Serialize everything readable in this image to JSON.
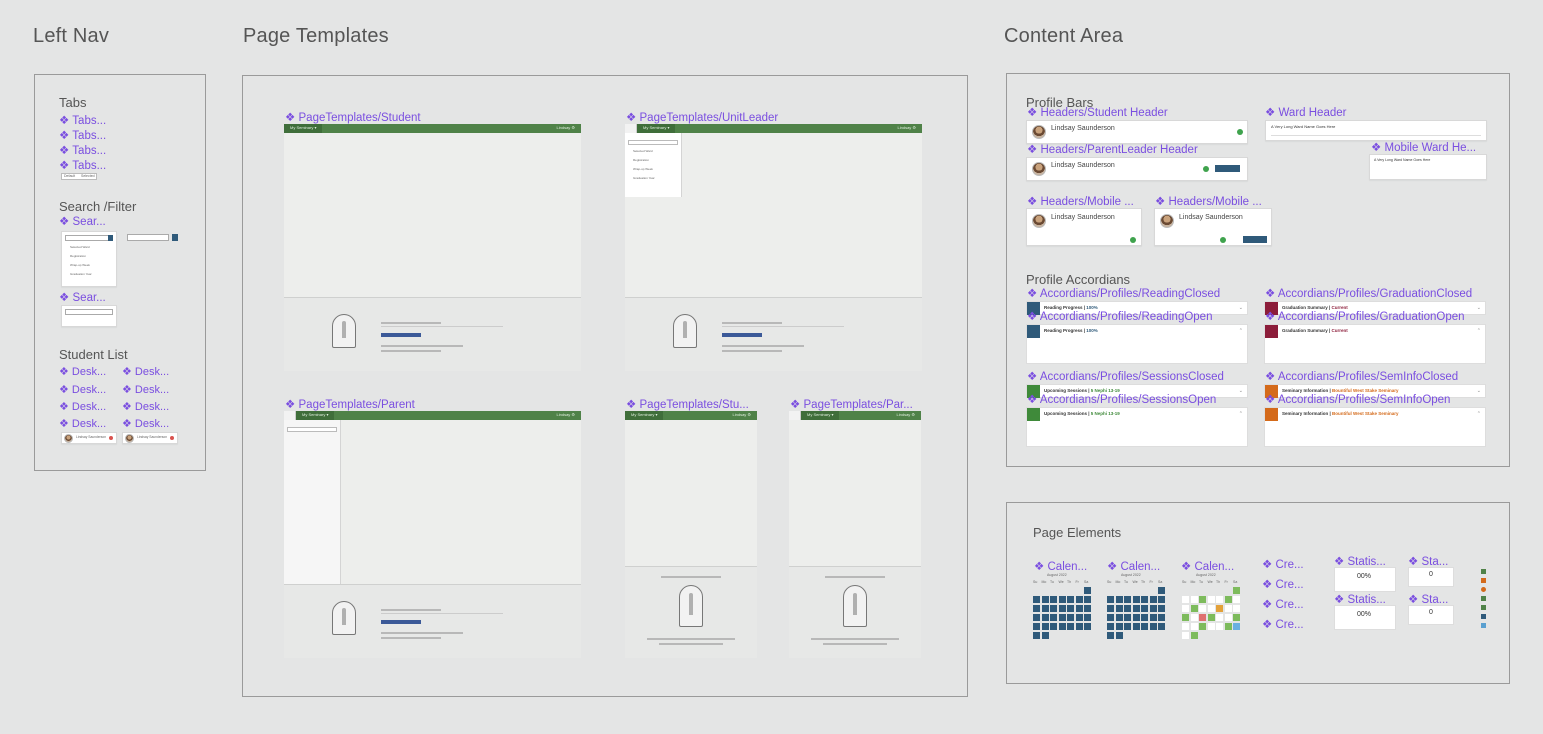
{
  "sections": {
    "left_nav": "Left Nav",
    "page_templates": "Page Templates",
    "content_area": "Content Area"
  },
  "left_nav": {
    "tabs_label": "Tabs",
    "tabs_components": [
      "❖ Tabs...",
      "❖ Tabs...",
      "❖ Tabs...",
      "❖ Tabs..."
    ],
    "tab_buttons": [
      "Default",
      "Selected"
    ],
    "search_label": "Search /Filter",
    "search_components": [
      "❖ Sear...",
      "❖ Sear..."
    ],
    "search_menu_items": [
      "Selected Ward",
      "Registration",
      "Wrap-up Week",
      "Graduation Year"
    ],
    "student_list_label": "Student List",
    "student_components": [
      "❖ Desk...",
      "❖ Desk...",
      "❖ Desk...",
      "❖ Desk...",
      "❖ Desk...",
      "❖ Desk...",
      "❖ Desk...",
      "❖ Desk..."
    ],
    "student_name": "Lindsay Saunderson"
  },
  "page_templates": {
    "student": "❖ PageTemplates/Student",
    "unit_leader": "❖ PageTemplates/UnitLeader",
    "parent": "❖ PageTemplates/Parent",
    "stu_mobile": "❖ PageTemplates/Stu...",
    "par_mobile": "❖ PageTemplates/Par...",
    "topbar_left": "My Seminary ▾",
    "topbar_right": "Lindsay ⚙"
  },
  "content_area": {
    "profile_bars_label": "Profile Bars",
    "student_header": "❖ Headers/Student Header",
    "ward_header": "❖ Ward Header",
    "parent_header": "❖ Headers/ParentLeader Header",
    "mobile_ward": "❖ Mobile Ward He...",
    "mobile_1": "❖ Headers/Mobile ...",
    "mobile_2": "❖ Headers/Mobile ...",
    "profile_name": "Lindsay Saunderson",
    "ward_name": "A Very Long Ward Name Goes Here",
    "accordions_label": "Profile Accordians",
    "acc_reading_closed": "❖ Accordians/Profiles/ReadingClosed",
    "acc_reading_open": "❖ Accordians/Profiles/ReadingOpen",
    "acc_grad_closed": "❖ Accordians/Profiles/GraduationClosed",
    "acc_grad_open": "❖ Accordians/Profiles/GraduationOpen",
    "acc_sessions_closed": "❖ Accordians/Profiles/SessionsClosed",
    "acc_sessions_open": "❖ Accordians/Profiles/SessionsOpen",
    "acc_seminfo_closed": "❖ Accordians/Profiles/SemInfoClosed",
    "acc_seminfo_open": "❖ Accordians/Profiles/SemInfoOpen",
    "reading_title": "Reading Progress",
    "reading_value": "100%",
    "grad_title": "Graduation Summary",
    "grad_value": "Current",
    "sessions_title": "Upcoming Sessions",
    "sessions_value": "5 Nephi 13-19",
    "seminfo_title": "Seminary Information",
    "seminfo_value": "Bountiful West Stake Seminary"
  },
  "page_elements": {
    "label": "Page Elements",
    "calendars": [
      "❖ Calen...",
      "❖ Calen...",
      "❖ Calen..."
    ],
    "cal_month": "August 2022",
    "cal_days": [
      "Su",
      "Mo",
      "Tu",
      "We",
      "Th",
      "Fr",
      "Sa"
    ],
    "creds": [
      "❖ Cre...",
      "❖ Cre...",
      "❖ Cre...",
      "❖ Cre..."
    ],
    "stats": [
      "❖ Statis...",
      "❖ Statis..."
    ],
    "stas": [
      "❖ Sta...",
      "❖ Sta..."
    ],
    "stat_values": [
      "00%",
      "00%",
      "0",
      "0"
    ]
  },
  "colors": {
    "component": "#7a4ee0",
    "nav_green": "#4f8248",
    "accent_blue": "#2f5a7a",
    "reading_blue": "#2f5a7a",
    "grad_maroon": "#8c1d3a",
    "sessions_green": "#3f8a3a",
    "seminfo_orange": "#d46a1a"
  }
}
